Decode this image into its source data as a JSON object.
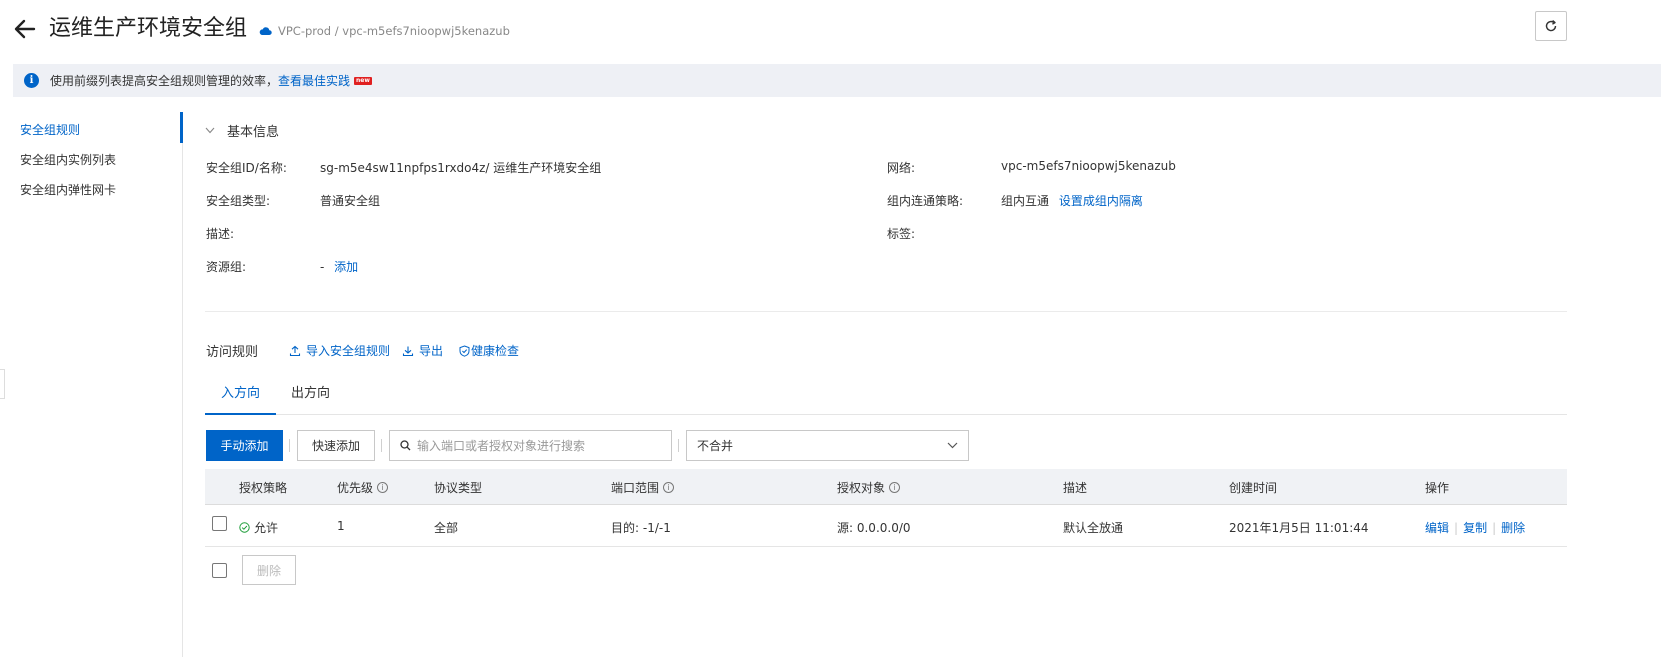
{
  "header": {
    "title": "运维生产环境安全组",
    "vpc_crumb": "VPC-prod / vpc-m5efs7nioopwj5kenazub",
    "back_icon": "arrow-left-icon",
    "cloud_icon": "cloud-icon",
    "refresh_icon": "refresh-icon"
  },
  "notice": {
    "text": "使用前缀列表提高安全组规则管理的效率，",
    "link": "查看最佳实践",
    "badge": "new",
    "icon": "info-icon",
    "accent": "#0064c8"
  },
  "sidebar": {
    "items": [
      {
        "label": "安全组规则",
        "active": true
      },
      {
        "label": "安全组内实例列表",
        "active": false
      },
      {
        "label": "安全组内弹性网卡",
        "active": false
      }
    ]
  },
  "basic_info": {
    "title": "基本信息",
    "sg_id_label": "安全组ID/名称:",
    "sg_id_value": "sg-m5e4sw11npfps1rxdo4z/ 运维生产环境安全组",
    "sg_type_label": "安全组类型:",
    "sg_type_value": "普通安全组",
    "desc_label": "描述:",
    "desc_value": "",
    "rg_label": "资源组:",
    "rg_value": "-",
    "rg_add": "添加",
    "network_label": "网络:",
    "network_value": "vpc-m5efs7nioopwj5kenazub",
    "policy_label": "组内连通策略:",
    "policy_value": "组内互通",
    "policy_link": "设置成组内隔离",
    "tags_label": "标签:",
    "tags_value": ""
  },
  "rules": {
    "title": "访问规则",
    "import_label": "导入安全组规则",
    "export_label": "导出",
    "health_label": "健康检查",
    "tabs": [
      {
        "label": "入方向",
        "active": true
      },
      {
        "label": "出方向",
        "active": false
      }
    ],
    "manual_add": "手动添加",
    "quick_add": "快速添加",
    "search_placeholder": "输入端口或者授权对象进行搜索",
    "merge_select": "不合并",
    "columns": {
      "policy": "授权策略",
      "priority": "优先级",
      "protocol": "协议类型",
      "port": "端口范围",
      "target": "授权对象",
      "desc": "描述",
      "created": "创建时间",
      "ops": "操作"
    },
    "rows": [
      {
        "policy": "允许",
        "priority": "1",
        "protocol": "全部",
        "port": "目的: -1/-1",
        "target": "源: 0.0.0.0/0",
        "desc": "默认全放通",
        "created": "2021年1月5日 11:01:44",
        "ops": {
          "edit": "编辑",
          "copy": "复制",
          "delete": "删除"
        }
      }
    ],
    "delete_button": "删除"
  }
}
